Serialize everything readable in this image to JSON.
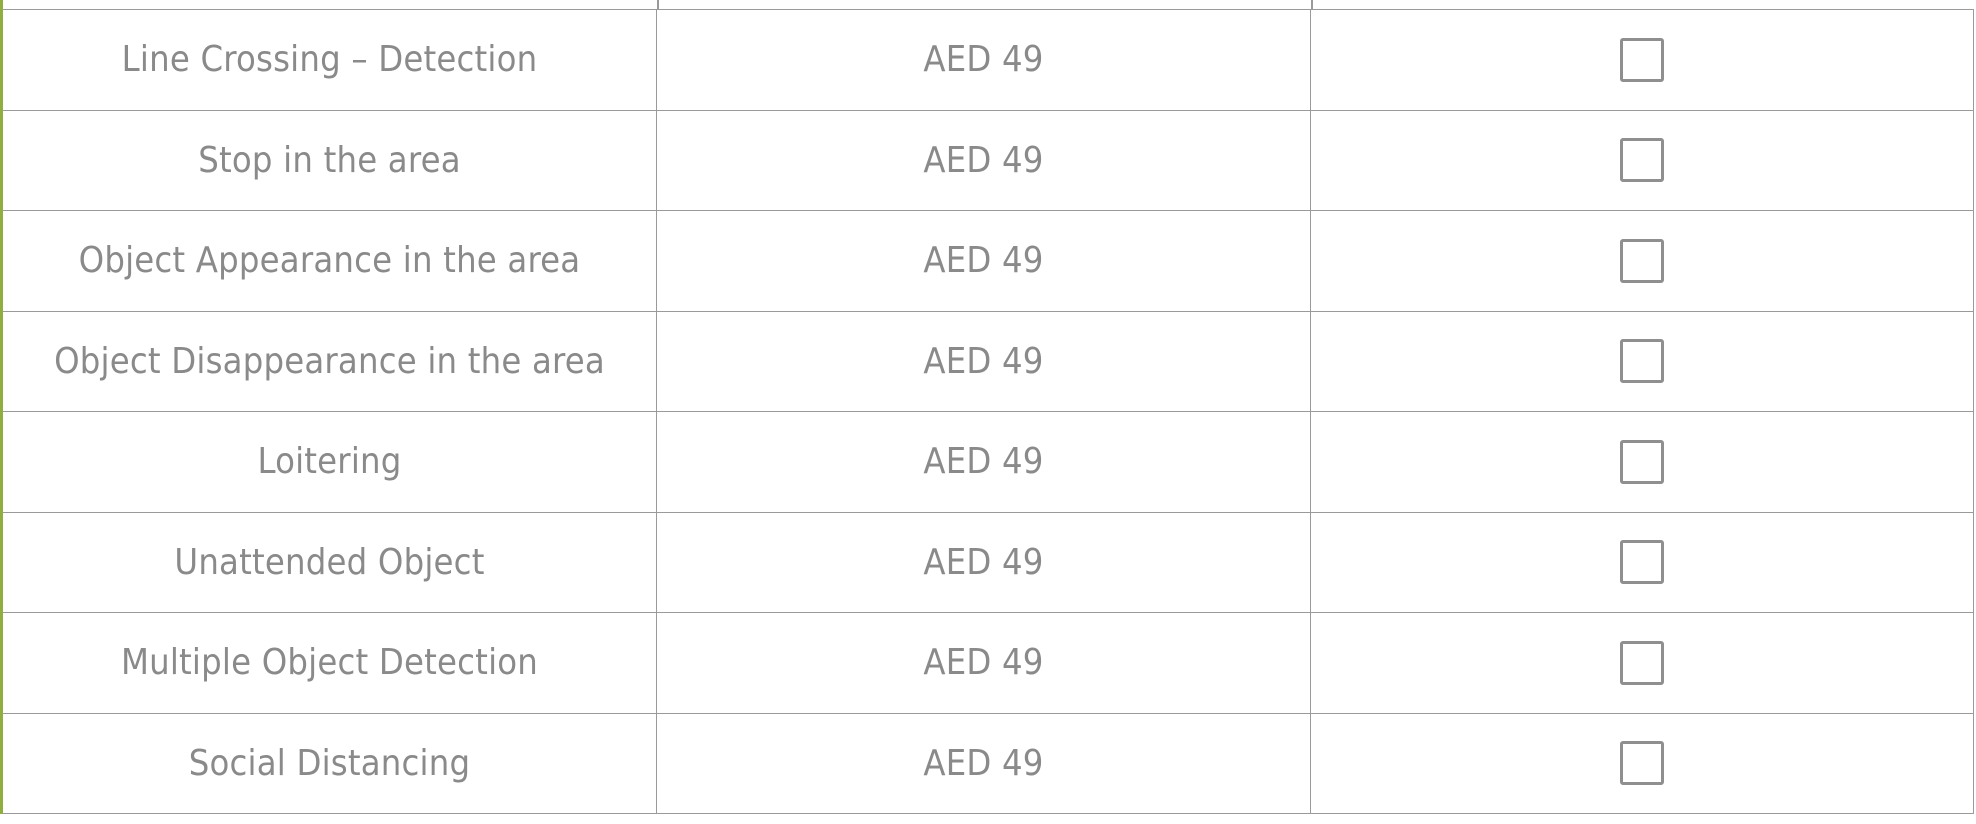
{
  "rows": [
    {
      "name": "Line Crossing – Detection",
      "price": "AED 49"
    },
    {
      "name": "Stop in the area",
      "price": "AED 49"
    },
    {
      "name": "Object Appearance in the area",
      "price": "AED 49"
    },
    {
      "name": "Object Disappearance in the area",
      "price": "AED 49"
    },
    {
      "name": "Loitering",
      "price": "AED 49"
    },
    {
      "name": "Unattended Object",
      "price": "AED 49"
    },
    {
      "name": "Multiple Object Detection",
      "price": "AED 49"
    },
    {
      "name": "Social Distancing",
      "price": "AED 49"
    }
  ],
  "colors": {
    "accent": "#8fae3e",
    "text": "#8a8a8a",
    "border": "#9a9a9a"
  },
  "icons": {
    "checkbox": "checkbox-unchecked-icon"
  }
}
